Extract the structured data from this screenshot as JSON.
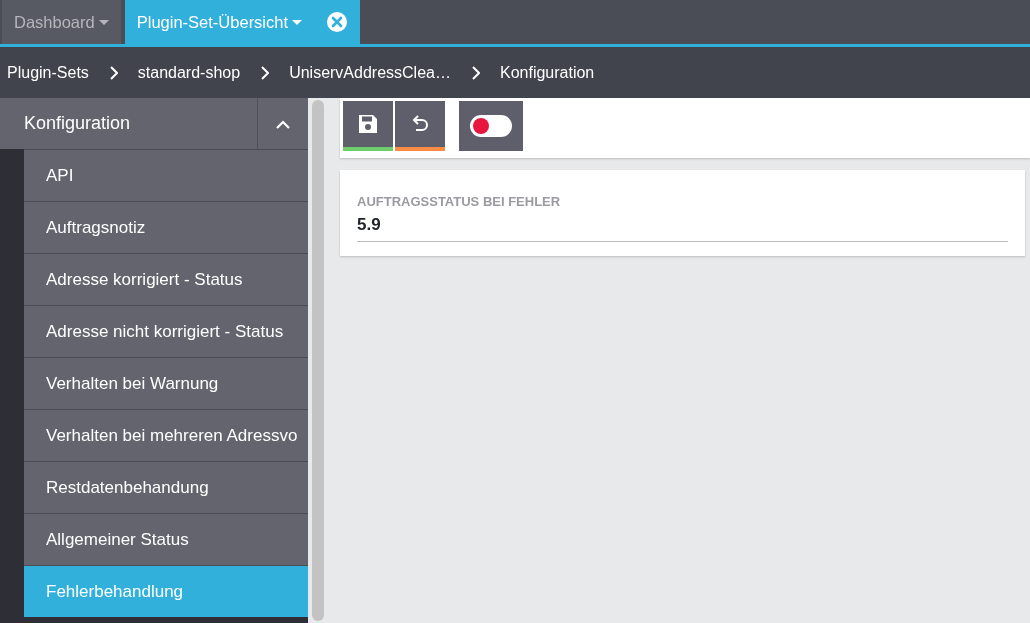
{
  "tabs": [
    {
      "label": "Dashboard",
      "selected": false,
      "closable": false
    },
    {
      "label": "Plugin-Set-Übersicht",
      "selected": true,
      "closable": true
    }
  ],
  "breadcrumbs": [
    "Plugin-Sets",
    "standard-shop",
    "UniservAddressClea…",
    "Konfiguration"
  ],
  "sidebar": {
    "title": "Konfiguration",
    "expanded": true,
    "items": [
      {
        "label": "API",
        "selected": false
      },
      {
        "label": "Auftragsnotiz",
        "selected": false
      },
      {
        "label": "Adresse korrigiert - Status",
        "selected": false
      },
      {
        "label": "Adresse nicht korrigiert - Status",
        "selected": false
      },
      {
        "label": "Verhalten bei Warnung",
        "selected": false
      },
      {
        "label": "Verhalten bei mehreren Adressvo",
        "selected": false
      },
      {
        "label": "Restdatenbehandung",
        "selected": false
      },
      {
        "label": "Allgemeiner Status",
        "selected": false
      },
      {
        "label": "Fehlerbehandlung",
        "selected": true
      }
    ]
  },
  "toolbar": {
    "toggle": {
      "on": false
    }
  },
  "field": {
    "label": "AUFTRAGSSTATUS BEI FEHLER",
    "value": "5.9"
  }
}
